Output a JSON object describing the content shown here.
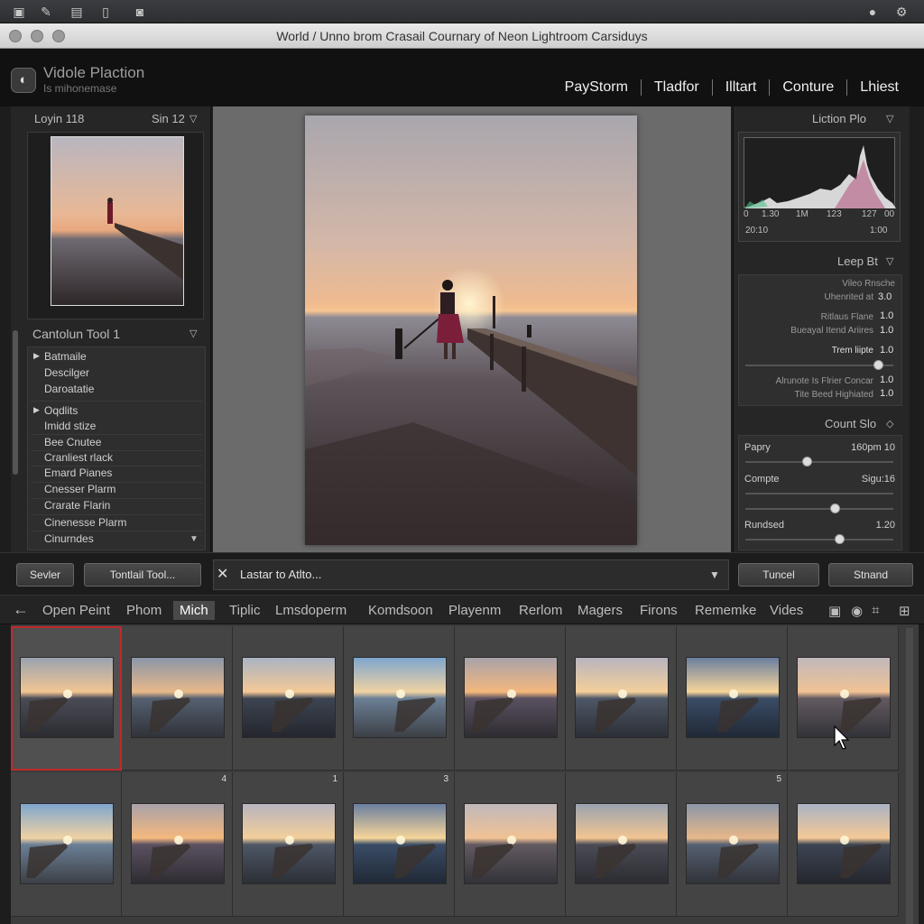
{
  "system_bar": {
    "icons": [
      "photo-stack-icon",
      "edit-icon",
      "layout-icon",
      "tablet-icon",
      "camera-icon",
      "info-icon",
      "settings-icon"
    ]
  },
  "window": {
    "title": "World / Unno brom Crasail Cournary of Neon Lightroom Carsiduys"
  },
  "app": {
    "name": "Vidole Plaction",
    "subtitle": "Is mihonemase"
  },
  "modules": [
    "PayStorm",
    "Tladfor",
    "Illtart",
    "Conture",
    "Lhiest"
  ],
  "left_panel": {
    "navigator_title": "Loyin 118",
    "navigator_zoom": "Sin 12",
    "collections_title": "Cantolun Tool 1",
    "groups": [
      {
        "label": "Batmaile",
        "expanded": true,
        "items": [
          "Descilger",
          "Daroatatie"
        ]
      },
      {
        "label": "Oqdlits",
        "expanded": true,
        "items": [
          "Imidd stize",
          "Bee Cnutee",
          "Cranliest rlack",
          "Emard Pianes",
          "Cnesser Plarm",
          "Crarate Flarin",
          "Cinenesse Plarm",
          "Cinurndes"
        ]
      }
    ]
  },
  "right_panel": {
    "histogram_title": "Liction Plo",
    "histogram_ticks": [
      "0",
      "1.30",
      "1M",
      "123",
      "127",
      "00"
    ],
    "histogram_left": "20:10",
    "histogram_right": "1:00",
    "basic_title": "Leep Bt",
    "basic_rows": [
      {
        "label": "Vileo Rnsche",
        "value": ""
      },
      {
        "label": "Uhenrited at",
        "value": "3.0"
      },
      {
        "label": "Ritlaus Flane",
        "value": "1.0"
      },
      {
        "label": "Bueayal Itend Ariires",
        "value": "1.0"
      },
      {
        "label": "Trem liipte",
        "value": "1.0"
      },
      {
        "label": "Alrunote Is Flrier Concar",
        "value": "1.0"
      },
      {
        "label": "Tite Beed Highiated",
        "value": "1.0"
      }
    ],
    "tone_title": "Count Slo",
    "tone_rows": [
      {
        "label": "Papry",
        "value": "160pm 10",
        "level": 0.42
      },
      {
        "label": "Compte",
        "value": "Sigu:16",
        "level": 0.61
      },
      {
        "label": "Rundsed",
        "value": "1.20",
        "level": 0.64
      }
    ],
    "basic_slider_level": 0.9
  },
  "toolbar": {
    "left_btn1": "Sevler",
    "left_btn2": "Tontlail Tool...",
    "center_label": "Lastar to Atlto...",
    "right_btn1": "Tuncel",
    "right_btn2": "Stnand"
  },
  "filter_bar": {
    "tabs": [
      "Open Peint",
      "Phom",
      "Mich",
      "Tiplic",
      "Lmsdoperm",
      "Komdsoon",
      "Playenm",
      "Rerlom",
      "Magers",
      "Firons",
      "Rememke",
      "Vides"
    ],
    "active_index": 2
  },
  "filmstrip": {
    "row1_numbers": [
      "",
      "",
      "",
      "",
      "",
      "",
      "",
      ""
    ],
    "row2_numbers": [
      "",
      "4",
      "1",
      "3",
      "",
      "",
      "5",
      ""
    ],
    "selected_index": 0
  },
  "colors": {
    "accent_selection": "#c0292a",
    "panel": "#262626",
    "background": "#1d1d1d"
  }
}
